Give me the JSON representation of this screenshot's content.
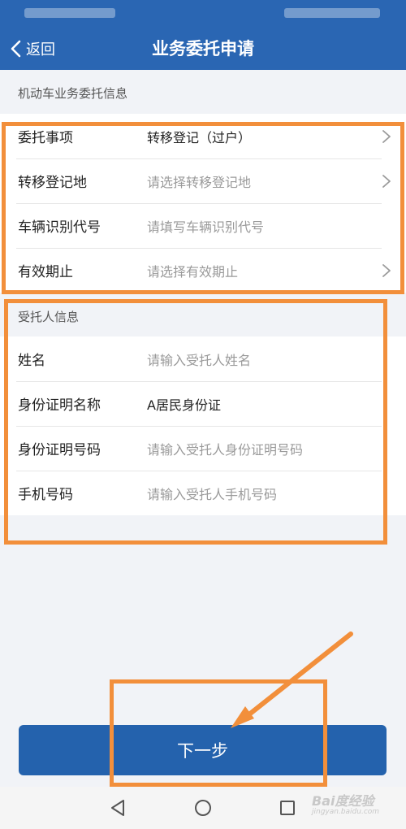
{
  "header": {
    "back_label": "返回",
    "title": "业务委托申请"
  },
  "section_vehicle": {
    "title": "机动车业务委托信息",
    "rows": [
      {
        "label": "委托事项",
        "value": "转移登记（过户）",
        "placeholder": ""
      },
      {
        "label": "转移登记地",
        "value": "",
        "placeholder": "请选择转移登记地"
      },
      {
        "label": "车辆识别代号",
        "value": "",
        "placeholder": "请填写车辆识别代号"
      },
      {
        "label": "有效期止",
        "value": "",
        "placeholder": "请选择有效期止"
      }
    ]
  },
  "section_trustee": {
    "title": "受托人信息",
    "rows": [
      {
        "label": "姓名",
        "value": "",
        "placeholder": "请输入受托人姓名"
      },
      {
        "label": "身份证明名称",
        "value": "A居民身份证",
        "placeholder": ""
      },
      {
        "label": "身份证明号码",
        "value": "",
        "placeholder": "请输入受托人身份证明号码"
      },
      {
        "label": "手机号码",
        "value": "",
        "placeholder": "请输入受托人手机号码"
      }
    ]
  },
  "footer": {
    "next_label": "下一步"
  },
  "watermark": {
    "brand": "Bai度经验",
    "url": "jingyan.baidu.com"
  },
  "colors": {
    "primary": "#2a66b3",
    "highlight": "#f28f3b",
    "arrow": "#f28f3b"
  },
  "icons": [
    "chevron-left-icon",
    "chevron-right-icon",
    "nav-back-icon",
    "nav-home-icon",
    "nav-recents-icon"
  ]
}
